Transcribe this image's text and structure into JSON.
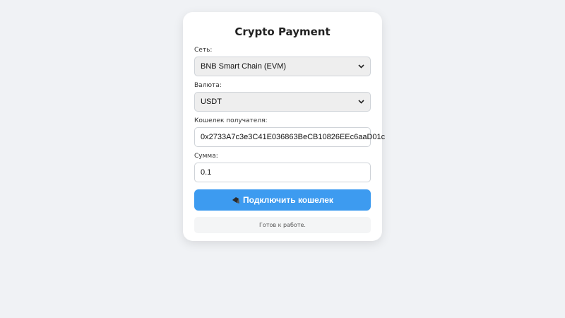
{
  "card": {
    "title": "Crypto Payment"
  },
  "network": {
    "label": "Сеть:",
    "selected": "BNB Smart Chain (EVM)"
  },
  "currency": {
    "label": "Валюта:",
    "selected": "USDT"
  },
  "wallet": {
    "label": "Кошелек получателя:",
    "value": "0x2733A7c3e3C41E036863BeCB10826EEc6aaD01c"
  },
  "amount": {
    "label": "Сумма:",
    "value": "0.1"
  },
  "connect": {
    "label": "Подключить кошелек",
    "icon": "wallet-icon"
  },
  "status": {
    "text": "Готов к работе."
  },
  "colors": {
    "background": "#f0f2f5",
    "accent": "#3d9bf0",
    "card": "#ffffff"
  }
}
